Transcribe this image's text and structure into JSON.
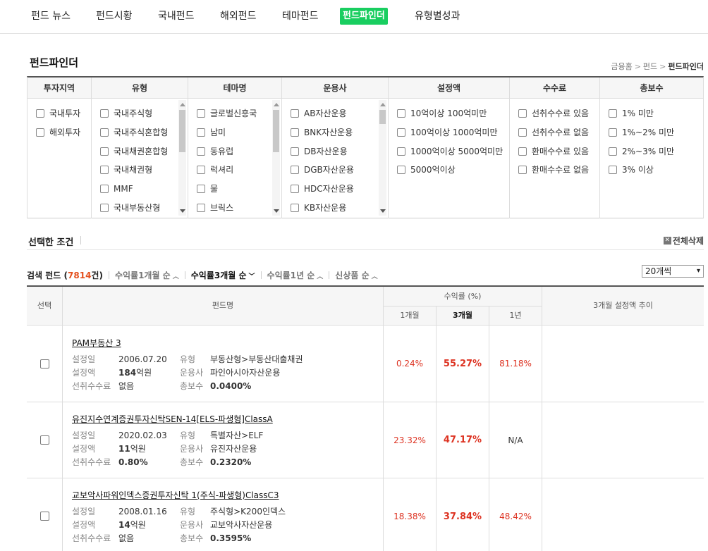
{
  "nav": {
    "tabs": [
      {
        "label": "펀드 뉴스",
        "active": false
      },
      {
        "label": "펀드시황",
        "active": false
      },
      {
        "label": "국내펀드",
        "active": false
      },
      {
        "label": "해외펀드",
        "active": false
      },
      {
        "label": "테마펀드",
        "active": false
      },
      {
        "label": "펀드파인더",
        "active": true
      },
      {
        "label": "유형별성과",
        "active": false
      }
    ],
    "accent_color": "#19ce60"
  },
  "page": {
    "title": "펀드파인더",
    "breadcrumb": [
      "금융홈",
      "펀드",
      "펀드파인더"
    ]
  },
  "filters": [
    {
      "label": "투자지역",
      "options": [
        "국내투자",
        "해외투자"
      ]
    },
    {
      "label": "유형",
      "options": [
        "국내주식형",
        "국내주식혼합형",
        "국내채권혼합형",
        "국내채권형",
        "MMF",
        "국내부동산형"
      ]
    },
    {
      "label": "테마명",
      "options": [
        "글로벌신흥국",
        "남미",
        "동유럽",
        "럭셔리",
        "물",
        "브릭스"
      ]
    },
    {
      "label": "운용사",
      "options": [
        "AB자산운용",
        "BNK자산운용",
        "DB자산운용",
        "DGB자산운용",
        "HDC자산운용",
        "KB자산운용"
      ]
    },
    {
      "label": "설정액",
      "options": [
        "10억이상 100억미만",
        "100억이상 1000억미만",
        "1000억이상 5000억미만",
        "5000억이상"
      ]
    },
    {
      "label": "수수료",
      "options": [
        "선취수수료 있음",
        "선취수수료 없음",
        "환매수수료 있음",
        "환매수수료 없음"
      ]
    },
    {
      "label": "총보수",
      "options": [
        "1% 미만",
        "1%~2% 미만",
        "2%~3% 미만",
        "3% 이상"
      ]
    }
  ],
  "conditions": {
    "label": "선택한 조건",
    "clear_all": "전체삭제"
  },
  "results": {
    "label_prefix": "검색 펀드 (",
    "count": "7814",
    "label_suffix": "건)",
    "sort_options": [
      {
        "label": "수익률1개월 순",
        "active": false
      },
      {
        "label": "수익률3개월 순",
        "active": true
      },
      {
        "label": "수익률1년 순",
        "active": false
      },
      {
        "label": "신상품 순",
        "active": false
      }
    ],
    "page_size": "20개씩"
  },
  "table": {
    "headers": {
      "select": "선택",
      "fund_name": "펀드명",
      "returns": "수익률 (%)",
      "m1": "1개월",
      "m3": "3개월",
      "y1": "1년",
      "trend": "3개월 설정액 추이"
    },
    "field_labels": {
      "inception": "설정일",
      "type": "유형",
      "amount": "설정액",
      "manager": "운용사",
      "front_fee": "선취수수료",
      "total_fee": "총보수"
    },
    "rows": [
      {
        "name": "PAM부동산 3",
        "inception": "2006.07.20",
        "type": "부동산형>부동산대출채권",
        "amount_num": "184",
        "amount_unit": "억원",
        "manager": "파인아시아자산운용",
        "front_fee": "없음",
        "total_fee": "0.0400%",
        "ret_1m": "0.24%",
        "ret_3m": "55.27%",
        "ret_1y": "81.18%"
      },
      {
        "name": "유진지수연계증권투자신탁SEN-14[ELS-파생형]ClassA",
        "inception": "2020.02.03",
        "type": "특별자산>ELF",
        "amount_num": "11",
        "amount_unit": "억원",
        "manager": "유진자산운용",
        "front_fee": "0.80%",
        "total_fee": "0.2320%",
        "ret_1m": "23.32%",
        "ret_3m": "47.17%",
        "ret_1y": "N/A"
      },
      {
        "name": "교보악사파워인덱스증권투자신탁 1(주식-파생형)ClassC3",
        "inception": "2008.01.16",
        "type": "주식형>K200인덱스",
        "amount_num": "14",
        "amount_unit": "억원",
        "manager": "교보악사자산운용",
        "front_fee": "없음",
        "total_fee": "0.3595%",
        "ret_1m": "18.38%",
        "ret_3m": "37.84%",
        "ret_1y": "48.42%"
      }
    ]
  }
}
